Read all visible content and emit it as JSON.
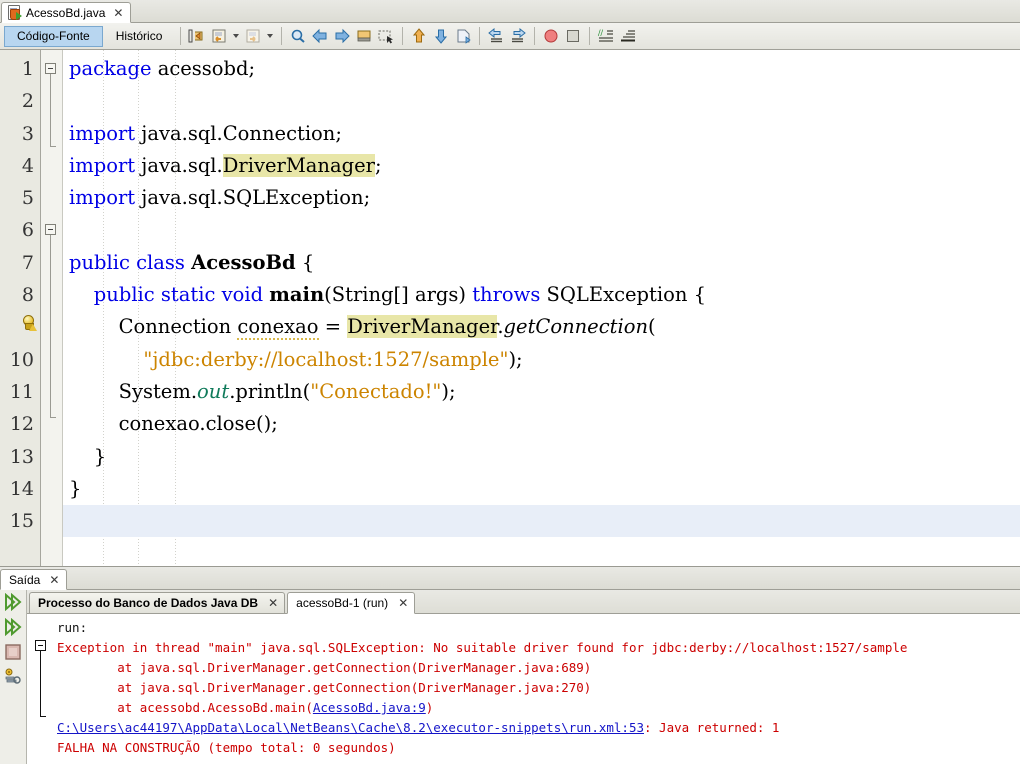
{
  "window": {
    "document_tab": {
      "label": "AcessoBd.java",
      "icon": "java-file-icon",
      "close": "✕"
    }
  },
  "toolbar": {
    "view_tabs": [
      {
        "label": "Código-Fonte",
        "active": true
      },
      {
        "label": "Histórico",
        "active": false
      }
    ],
    "buttons": [
      {
        "name": "toggle-rectangular-selection-icon"
      },
      {
        "name": "last-edit-icon"
      },
      {
        "name": "last-edit-dropdown-icon"
      },
      {
        "name": "forward-edit-icon"
      },
      {
        "name": "forward-edit-dropdown-icon"
      },
      {
        "name": "find-selection-icon"
      },
      {
        "name": "previous-bookmark-icon"
      },
      {
        "name": "next-bookmark-icon"
      },
      {
        "name": "toggle-bookmark-icon"
      },
      {
        "name": "toggle-rectangular-icon"
      },
      {
        "name": "previous-error-icon"
      },
      {
        "name": "next-error-icon"
      },
      {
        "name": "shift-line-left-icon"
      },
      {
        "name": "shift-line-right-icon"
      },
      {
        "name": "start-macro-recording-icon"
      },
      {
        "name": "stop-macro-recording-icon"
      },
      {
        "name": "comment-icon"
      },
      {
        "name": "uncomment-icon"
      }
    ]
  },
  "editor": {
    "line_numbers": [
      "1",
      "2",
      "3",
      "4",
      "5",
      "6",
      "7",
      "8",
      "",
      "10",
      "11",
      "12",
      "13",
      "14",
      "15"
    ],
    "hint_line_index": 8,
    "hint_icon": "lightbulb-warning-icon",
    "current_line": 15,
    "lines": [
      {
        "n": 1,
        "html": "<span class='kw'>package</span> acessobd;"
      },
      {
        "n": 2,
        "html": ""
      },
      {
        "n": 3,
        "html": "<span class='kw'>import</span> java.sql.Connection;"
      },
      {
        "n": 4,
        "html": "<span class='kw'>import</span> java.sql.<span class='hl'>DriverManager</span>;"
      },
      {
        "n": 5,
        "html": "<span class='kw'>import</span> java.sql.SQLException;"
      },
      {
        "n": 6,
        "html": ""
      },
      {
        "n": 7,
        "html": "<span class='kw'>public</span> <span class='kw'>class</span> <span class='bld'>AcessoBd</span> {"
      },
      {
        "n": 8,
        "html": "    <span class='kw'>public</span> <span class='kw'>static</span> <span class='kw'>void</span> <span class='bld'>main</span>(String[] args) <span class='kw'>throws</span> SQLException {"
      },
      {
        "n": 9,
        "html": "        Connection <span class='sq'>conexao</span> = <span class='hl'>DriverManager</span>.<span class='mth'>getConnection</span>("
      },
      {
        "n": 10,
        "html": "            <span class='str'>\"jdbc:derby://localhost:1527/sample\"</span>);"
      },
      {
        "n": 11,
        "html": "        System.<span class='fld'>out</span>.println(<span class='str'>\"Conectado!\"</span>);"
      },
      {
        "n": 12,
        "html": "        conexao.close();"
      },
      {
        "n": 13,
        "html": "    }"
      },
      {
        "n": 14,
        "html": "}"
      },
      {
        "n": 15,
        "html": ""
      }
    ],
    "plain_lines": [
      "package acessobd;",
      "",
      "import java.sql.Connection;",
      "import java.sql.DriverManager;",
      "import java.sql.SQLException;",
      "",
      "public class AcessoBd {",
      "    public static void main(String[] args) throws SQLException {",
      "        Connection conexao = DriverManager.getConnection(",
      "            \"jdbc:derby://localhost:1527/sample\");",
      "        System.out.println(\"Conectado!\");",
      "        conexao.close();",
      "    }",
      "}",
      ""
    ]
  },
  "output": {
    "window_tab": {
      "label": "Saída",
      "close": "✕"
    },
    "side_icons": [
      {
        "name": "rerun-icon"
      },
      {
        "name": "rerun-alt-icon"
      },
      {
        "name": "stop-icon"
      },
      {
        "name": "settings-icon"
      }
    ],
    "tabs": [
      {
        "label": "Processo do Banco de Dados Java DB",
        "close": "✕",
        "active": false,
        "bold": true
      },
      {
        "label": "acessoBd-1 (run)",
        "close": "✕",
        "active": true,
        "bold": false
      }
    ],
    "console_lines": [
      {
        "type": "plain",
        "text": "run:"
      },
      {
        "type": "error",
        "text": "Exception in thread \"main\" java.sql.SQLException: No suitable driver found for jdbc:derby://localhost:1527/sample"
      },
      {
        "type": "error",
        "text": "        at java.sql.DriverManager.getConnection(DriverManager.java:689)"
      },
      {
        "type": "error",
        "text": "        at java.sql.DriverManager.getConnection(DriverManager.java:270)"
      },
      {
        "type": "error-link",
        "pre": "        at acessobd.AcessoBd.main(",
        "link": "AcessoBd.java:9",
        "post": ")"
      },
      {
        "type": "link-suffix",
        "link": "C:\\Users\\ac44197\\AppData\\Local\\NetBeans\\Cache\\8.2\\executor-snippets\\run.xml:53",
        "post": ": Java returned: 1"
      },
      {
        "type": "error",
        "text": "FALHA NA CONSTRUÇÃO (tempo total: 0 segundos)"
      }
    ]
  },
  "colors": {
    "keyword": "#0000e6",
    "string": "#cc8400",
    "field": "#0f7a5a",
    "highlight": "#e8e6a8",
    "current_line": "#e8eef8",
    "error_text": "#cc0000",
    "link": "#1414c8",
    "tab_active": "#b8d6f0"
  }
}
